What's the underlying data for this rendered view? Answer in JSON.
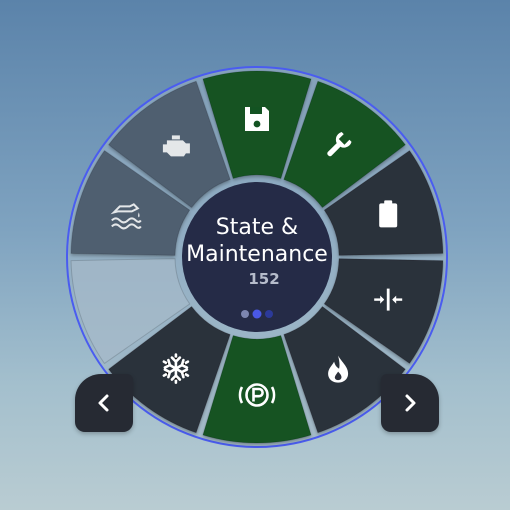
{
  "colors": {
    "ring_background": "#9fb4c4",
    "ring_border": "#4a5cf0",
    "segment_dark": "#2c303a",
    "segment_muted": "#4f5e70",
    "segment_active": "#135322",
    "segment_empty": "#a9bccb",
    "center_fill": "#252b47"
  },
  "center": {
    "title_line1": "State &",
    "title_line2": "Maintenance",
    "count": "152",
    "page_dots": [
      {
        "state": "inactive",
        "color": "#7d86b0"
      },
      {
        "state": "active",
        "color": "#4a58e6"
      },
      {
        "state": "inactive",
        "color": "#2c3a9a"
      }
    ]
  },
  "segments": [
    {
      "icon": "floppy-disk-icon",
      "state": "active"
    },
    {
      "icon": "wrench-icon",
      "state": "active"
    },
    {
      "icon": "battery-icon",
      "state": "normal"
    },
    {
      "icon": "compress-arrows-icon",
      "state": "normal"
    },
    {
      "icon": "flame-icon",
      "state": "normal"
    },
    {
      "icon": "parking-brake-icon",
      "state": "active"
    },
    {
      "icon": "snowflake-icon",
      "state": "normal"
    },
    {
      "icon": "empty-slot",
      "state": "empty"
    },
    {
      "icon": "oil-level-icon",
      "state": "muted"
    },
    {
      "icon": "engine-icon",
      "state": "muted"
    }
  ],
  "nav": {
    "prev_icon": "chevron-left-icon",
    "next_icon": "chevron-right-icon"
  }
}
